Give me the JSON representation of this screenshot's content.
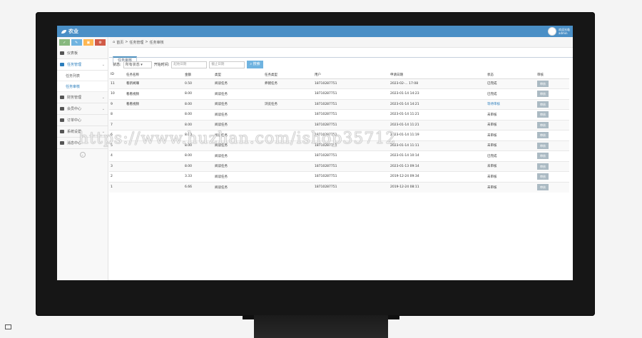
{
  "app": {
    "brand": "农业",
    "user_greeting": "欢迎光临",
    "user_name": "admin"
  },
  "sidebar": {
    "shortcuts": [
      "✓",
      "✎",
      "▣",
      "⚙"
    ],
    "items": [
      {
        "label": "仪表板",
        "icon": "dashboard-icon"
      },
      {
        "label": "任务管理",
        "icon": "list-icon",
        "expanded": true,
        "children": [
          "任务列表",
          "任务审核"
        ]
      },
      {
        "label": "财务管理",
        "icon": "finance-icon"
      },
      {
        "label": "会员中心",
        "icon": "user-icon"
      },
      {
        "label": "订单中心",
        "icon": "cart-icon"
      },
      {
        "label": "系统设置",
        "icon": "gear-icon"
      },
      {
        "label": "消息中心",
        "icon": "bookmark-icon"
      }
    ],
    "collapse_glyph": "«"
  },
  "breadcrumb": {
    "home": "首页",
    "sep": ">",
    "section": "任务管理",
    "page": "任务审核"
  },
  "tab": {
    "label": "任务审核"
  },
  "filters": {
    "status_label": "状态:",
    "status_value": "所有状态",
    "date_label": "开始时间:",
    "start_placeholder": "起始日期",
    "end_placeholder": "截止日期",
    "search_label": "搜索"
  },
  "table": {
    "headers": [
      "ID",
      "任务名称",
      "金额",
      "类型",
      "任务类型",
      "用户",
      "申请日期",
      "状态",
      "审核"
    ],
    "rows": [
      {
        "id": "11",
        "name": "看新闻赚",
        "amount": "0.50",
        "type": "阅读任务",
        "task_type": "养猪任务",
        "user": "18710287751",
        "date": "2023-02-... 17:08",
        "status": "已完成",
        "action": "审核"
      },
      {
        "id": "10",
        "name": "看看视频",
        "amount": "8.00",
        "type": "阅读任务",
        "task_type": "",
        "user": "18710287751",
        "date": "2023-01-14 14:23",
        "status": "已完成",
        "action": "审核"
      },
      {
        "id": "9",
        "name": "看看视频",
        "amount": "8.00",
        "type": "阅读任务",
        "task_type": "浏览任务",
        "user": "18710287751",
        "date": "2023-01-14 14:21",
        "status": "等待审核",
        "action": "审核"
      },
      {
        "id": "8",
        "name": "",
        "amount": "8.00",
        "type": "阅读任务",
        "task_type": "",
        "user": "18710287751",
        "date": "2023-01-14 11:21",
        "status": "未审核",
        "action": "审核"
      },
      {
        "id": "7",
        "name": "",
        "amount": "8.00",
        "type": "阅读任务",
        "task_type": "",
        "user": "18710287751",
        "date": "2023-01-14 11:21",
        "status": "未审核",
        "action": "审核"
      },
      {
        "id": "6",
        "name": "",
        "amount": "8.00",
        "type": "阅读任务",
        "task_type": "",
        "user": "18710287751",
        "date": "2023-01-14 11:19",
        "status": "未审核",
        "action": "审核"
      },
      {
        "id": "5",
        "name": "",
        "amount": "8.00",
        "type": "阅读任务",
        "task_type": "",
        "user": "18710287751",
        "date": "2023-01-14 11:11",
        "status": "未审核",
        "action": "审核"
      },
      {
        "id": "4",
        "name": "",
        "amount": "8.00",
        "type": "阅读任务",
        "task_type": "",
        "user": "18710287751",
        "date": "2023-01-14 10:14",
        "status": "已完成",
        "action": "审核"
      },
      {
        "id": "3",
        "name": "",
        "amount": "8.00",
        "type": "阅读任务",
        "task_type": "",
        "user": "18710287751",
        "date": "2023-01-13 09:14",
        "status": "未审核",
        "action": "审核"
      },
      {
        "id": "2",
        "name": "",
        "amount": "3.33",
        "type": "阅读任务",
        "task_type": "",
        "user": "18710287751",
        "date": "2019-12-24 09:34",
        "status": "未审核",
        "action": "审核"
      },
      {
        "id": "1",
        "name": "",
        "amount": "6.66",
        "type": "阅读任务",
        "task_type": "",
        "user": "18710287751",
        "date": "2019-12-24 08:11",
        "status": "未审核",
        "action": "审核"
      }
    ]
  },
  "watermark": "https://www.huzhan.com/ishop35712",
  "colors": {
    "header": "#4a8fc6",
    "link": "#2b7dbc",
    "search_button": "#6fb3e0",
    "op_button": "#abbac3"
  }
}
